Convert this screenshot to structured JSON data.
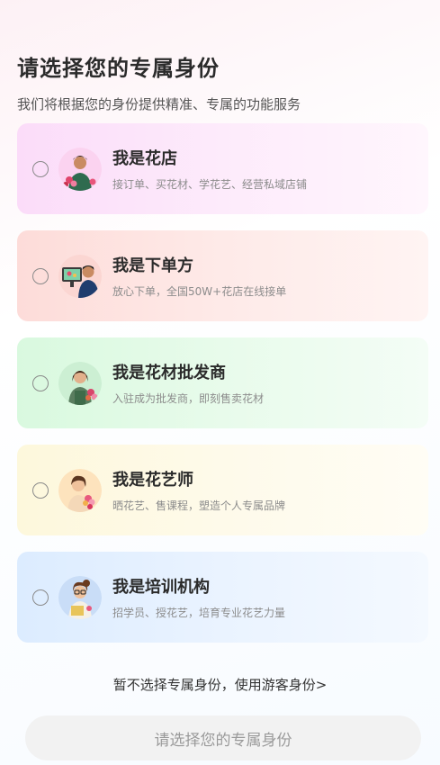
{
  "header": {
    "title": "请选择您的专属身份",
    "subtitle": "我们将根据您的身份提供精准、专属的功能服务"
  },
  "roles": [
    {
      "title": "我是花店",
      "desc": "接订单、买花材、学花艺、经营私域店铺",
      "avatar": "florist-avatar",
      "accent": "#fbdcf9"
    },
    {
      "title": "我是下单方",
      "desc": "放心下单，全国50W+花店在线接单",
      "avatar": "buyer-avatar",
      "accent": "#fddcd9"
    },
    {
      "title": "我是花材批发商",
      "desc": "入驻成为批发商，即刻售卖花材",
      "avatar": "wholesaler-avatar",
      "accent": "#d9f9df"
    },
    {
      "title": "我是花艺师",
      "desc": "晒花艺、售课程，塑造个人专属品牌",
      "avatar": "floral-artist-avatar",
      "accent": "#fdf8dc"
    },
    {
      "title": "我是培训机构",
      "desc": "招学员、授花艺，培育专业花艺力量",
      "avatar": "training-org-avatar",
      "accent": "#dcecff"
    }
  ],
  "guest_link": "暂不选择专属身份，使用游客身份>",
  "confirm_button": "请选择您的专属身份"
}
